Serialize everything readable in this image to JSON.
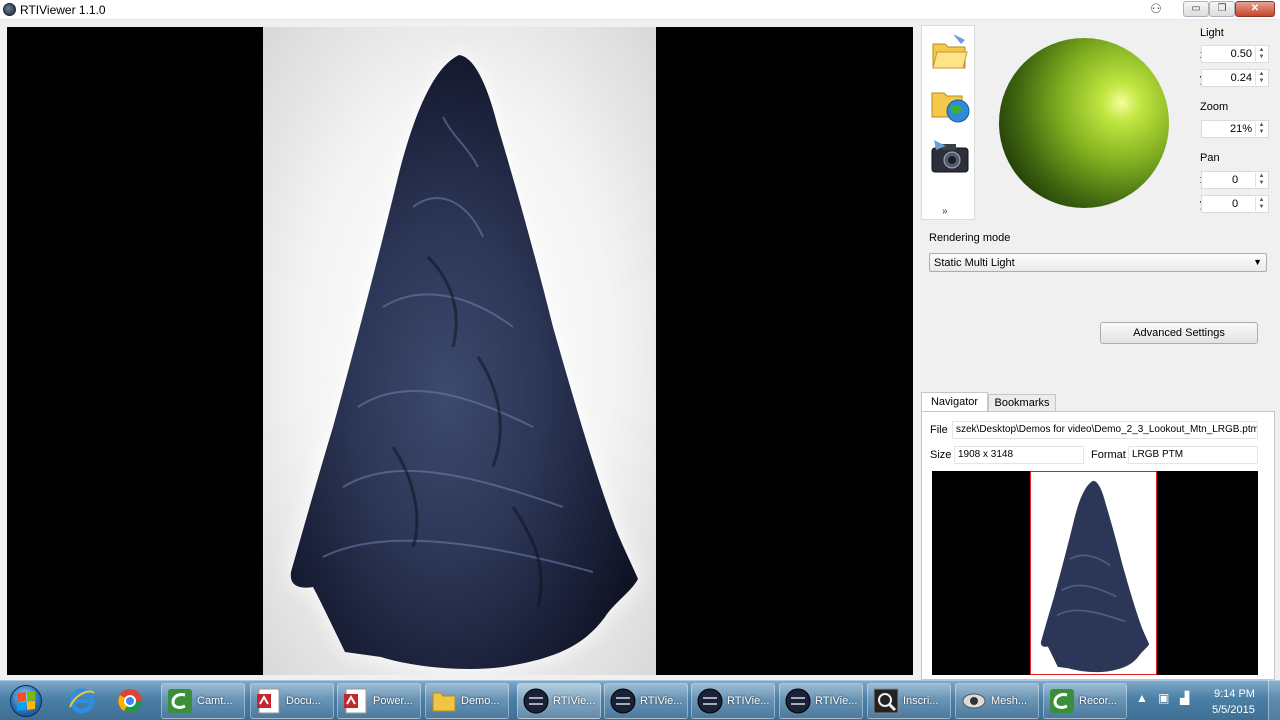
{
  "window": {
    "title": "RTIViewer 1.1.0",
    "controls": {
      "minimize": "▭",
      "maximize": "❐",
      "close": "✕"
    }
  },
  "toolbar": {
    "icons": [
      "open-folder-icon",
      "open-remote-icon",
      "snapshot-camera-icon"
    ],
    "more_glyph": "»"
  },
  "light": {
    "label": "Light",
    "x_label": "x",
    "x_value": "0.50",
    "y_label": "y",
    "y_value": "0.24"
  },
  "zoom": {
    "label": "Zoom",
    "value": "21%"
  },
  "pan": {
    "label": "Pan",
    "x_label": "x",
    "x_value": "0",
    "y_label": "y",
    "y_value": "0"
  },
  "rendering": {
    "label": "Rendering mode",
    "selected": "Static Multi Light"
  },
  "advanced_button": "Advanced Settings",
  "navigator": {
    "tabs": [
      "Navigator",
      "Bookmarks"
    ],
    "active_tab": "Navigator",
    "file_label": "File",
    "file_value": "szek\\Desktop\\Demos for video\\Demo_2_3_Lookout_Mtn_LRGB.ptm",
    "size_label": "Size",
    "size_value": "1908 x 3148",
    "format_label": "Format",
    "format_value": "LRGB PTM"
  },
  "taskbar": {
    "pinned": [
      "internet-explorer-icon",
      "chrome-icon"
    ],
    "tasks": [
      {
        "label": "Camt...",
        "icon": "camtasia-icon"
      },
      {
        "label": "Docu...",
        "icon": "acrobat-icon"
      },
      {
        "label": "Power...",
        "icon": "acrobat-icon"
      },
      {
        "label": "Demo...",
        "icon": "folder-icon"
      },
      {
        "label": "RTIVie...",
        "icon": "rtiviewer-icon"
      },
      {
        "label": "RTIVie...",
        "icon": "rtiviewer-icon"
      },
      {
        "label": "RTIVie...",
        "icon": "rtiviewer-icon"
      },
      {
        "label": "RTIVie...",
        "icon": "rtiviewer-icon"
      },
      {
        "label": "Inscri...",
        "icon": "inscription-icon"
      },
      {
        "label": "Mesh...",
        "icon": "meshlab-icon"
      },
      {
        "label": "Recor...",
        "icon": "camtasia-recorder-icon"
      }
    ],
    "clock_time": "9:14 PM",
    "clock_date": "5/5/2015"
  }
}
